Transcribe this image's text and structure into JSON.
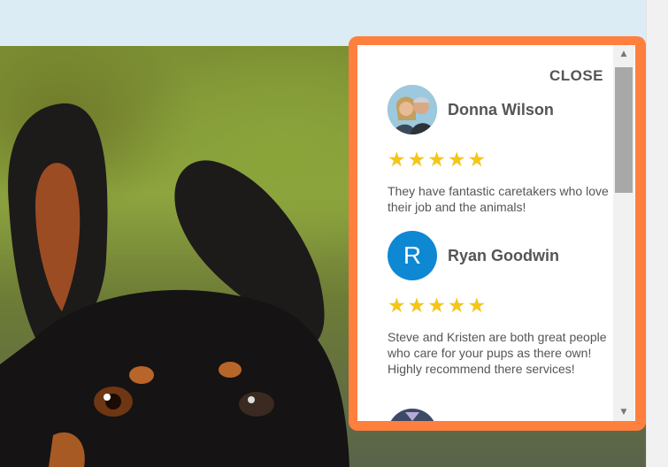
{
  "popup": {
    "close_label": "CLOSE",
    "accent_color": "#ff7f3f",
    "reviews": [
      {
        "name": "Donna Wilson",
        "avatar": "photo-avatar",
        "rating": 5,
        "stars": "★★★★★",
        "text": "They have fantastic caretakers who love their job and the animals!"
      },
      {
        "name": "Ryan Goodwin",
        "avatar_letter": "R",
        "avatar_color": "#0e88d3",
        "rating": 5,
        "stars": "★★★★★",
        "text": "Steve and Kristen are both great people who care for your pups as there own! Highly recommend there services!"
      }
    ]
  },
  "scroll": {
    "up_icon": "▲",
    "down_icon": "▼"
  }
}
